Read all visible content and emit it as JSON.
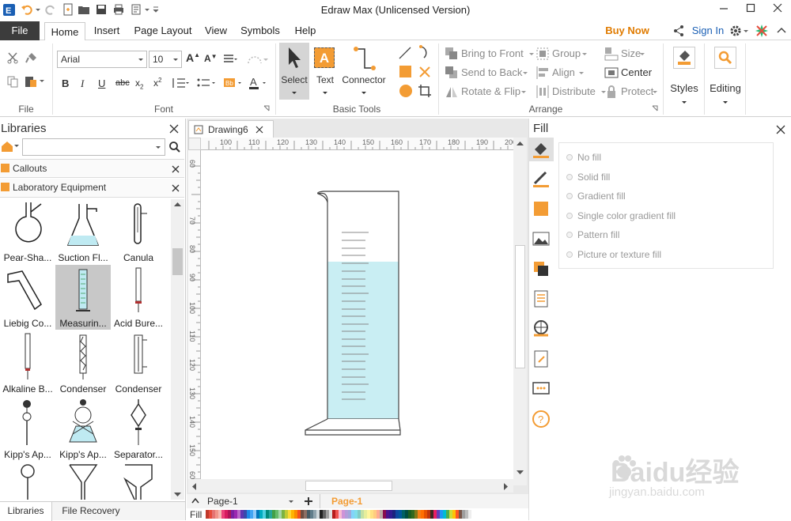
{
  "window": {
    "title": "Edraw Max (Unlicensed Version)"
  },
  "menu": {
    "file": "File",
    "tabs": [
      "Home",
      "Insert",
      "Page Layout",
      "View",
      "Symbols",
      "Help"
    ],
    "buy_now": "Buy Now",
    "sign_in": "Sign In"
  },
  "ribbon": {
    "font_name": "Arial",
    "font_size": "10",
    "groups": {
      "file": "File",
      "font": "Font",
      "basic_tools": "Basic Tools",
      "arrange": "Arrange"
    },
    "tools": {
      "select": "Select",
      "text": "Text",
      "connector": "Connector"
    },
    "arrange": {
      "bring_to_front": "Bring to Front",
      "send_to_back": "Send to Back",
      "rotate_flip": "Rotate & Flip",
      "group": "Group",
      "align": "Align",
      "distribute": "Distribute",
      "size": "Size",
      "center": "Center",
      "protect": "Protect"
    },
    "styles": "Styles",
    "editing": "Editing"
  },
  "libraries": {
    "title": "Libraries",
    "sections": [
      "Callouts",
      "Laboratory Equipment"
    ],
    "items": [
      {
        "label": "Pear-Sha...",
        "icon": "pear-flask-icon"
      },
      {
        "label": "Suction Fl...",
        "icon": "suction-flask-icon"
      },
      {
        "label": "Canula",
        "icon": "canula-icon"
      },
      {
        "label": "Liebig Co...",
        "icon": "liebig-condenser-icon"
      },
      {
        "label": "Measurin...",
        "icon": "measuring-cylinder-icon"
      },
      {
        "label": "Acid Bure...",
        "icon": "acid-burette-icon"
      },
      {
        "label": "Alkaline B...",
        "icon": "alkaline-burette-icon"
      },
      {
        "label": "Condenser",
        "icon": "condenser-icon"
      },
      {
        "label": "Condenser",
        "icon": "condenser-icon"
      },
      {
        "label": "Kipp's Ap...",
        "icon": "kipp-apparatus-icon"
      },
      {
        "label": "Kipp's Ap...",
        "icon": "kipp-apparatus-icon"
      },
      {
        "label": "Separator...",
        "icon": "separator-funnel-icon"
      },
      {
        "label": "",
        "icon": "pipette-icon"
      },
      {
        "label": "",
        "icon": "funnel-icon"
      },
      {
        "label": "",
        "icon": "buchner-funnel-icon"
      }
    ],
    "bottom_tabs": [
      "Libraries",
      "File Recovery"
    ]
  },
  "document": {
    "tab": "Drawing6",
    "ruler_h": [
      "100",
      "110",
      "120",
      "130",
      "140",
      "150",
      "160",
      "170",
      "180",
      "190",
      "200"
    ],
    "ruler_v": [
      "60",
      "70",
      "80",
      "90",
      "100",
      "110",
      "120",
      "130",
      "140",
      "150",
      "60"
    ],
    "page_select": "Page-1",
    "page_tab": "Page-1",
    "fill_label": "Fill"
  },
  "fill_panel": {
    "title": "Fill",
    "options": [
      "No fill",
      "Solid fill",
      "Gradient fill",
      "Single color gradient fill",
      "Pattern fill",
      "Picture or texture fill"
    ]
  },
  "colors": {
    "accent": "#f39c34",
    "brand_blue": "#1a5fb4",
    "water": "#c9eef3",
    "buy_now": "#e07b00"
  },
  "watermark": {
    "line1": "Baidu经验",
    "line2": "jingyan.baidu.com"
  }
}
